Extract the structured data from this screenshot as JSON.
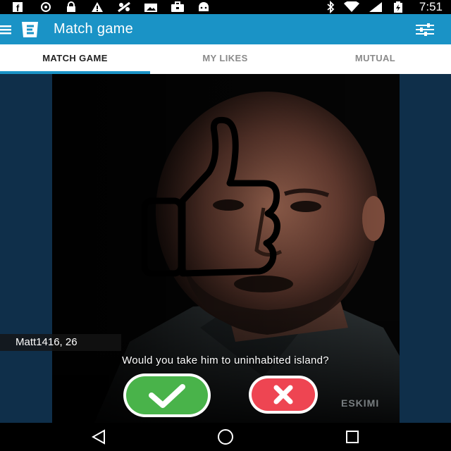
{
  "status_bar": {
    "time": "7:51",
    "left_icons": [
      "facebook-icon",
      "sync-icon",
      "lock-icon",
      "warning-icon",
      "fake-gps-icon",
      "photo-icon",
      "work-icon",
      "android-icon"
    ],
    "right_icons": [
      "bluetooth-icon",
      "wifi-icon",
      "signal-icon",
      "battery-charging-icon"
    ]
  },
  "app_bar": {
    "title": "Match game",
    "color": "#1a93c6"
  },
  "tabs": [
    {
      "label": "MATCH GAME",
      "active": true
    },
    {
      "label": "MY LIKES",
      "active": false
    },
    {
      "label": "MUTUAL",
      "active": false
    }
  ],
  "card": {
    "name_age": "Matt1416, 26",
    "question": "Would you take him to uninhabited island?",
    "overlay_icon": "thumbs-up-icon",
    "watermark": "ESKIMI"
  },
  "actions": {
    "like_icon": "checkmark-icon",
    "like_color": "#49b34a",
    "nope_icon": "x-icon",
    "nope_color": "#ee4552"
  },
  "nav_bar": {
    "icons": [
      "back-icon",
      "home-icon",
      "recents-icon"
    ]
  }
}
